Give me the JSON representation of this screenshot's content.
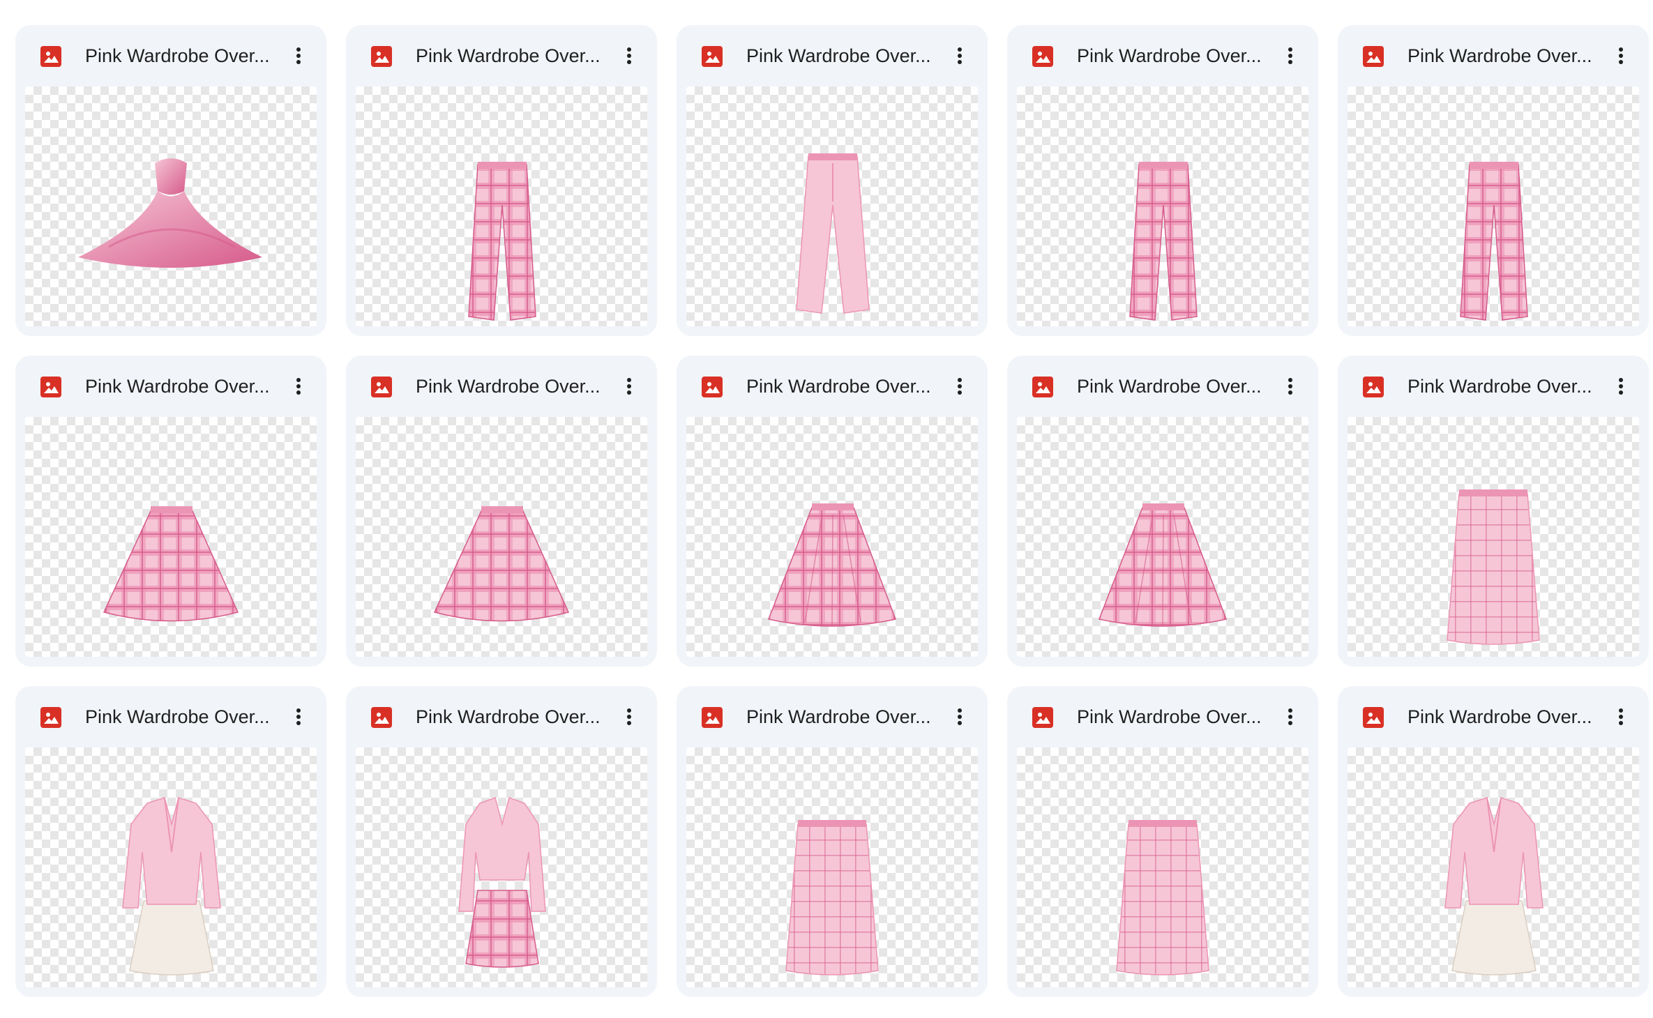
{
  "colors": {
    "card_bg": "#f1f4f9",
    "file_icon": "#d93025",
    "title_text": "#1f1f1f",
    "pink_light": "#f6c6d6",
    "pink_mid": "#ec94b4",
    "pink_dark": "#d65a8a",
    "cream": "#f3ece4"
  },
  "files": [
    {
      "name": "Pink Wardrobe Over...",
      "icon": "image-file-icon",
      "thumbnail": "ball-gown"
    },
    {
      "name": "Pink Wardrobe Over...",
      "icon": "image-file-icon",
      "thumbnail": "plaid-trousers"
    },
    {
      "name": "Pink Wardrobe Over...",
      "icon": "image-file-icon",
      "thumbnail": "solid-trousers"
    },
    {
      "name": "Pink Wardrobe Over...",
      "icon": "image-file-icon",
      "thumbnail": "plaid-trousers"
    },
    {
      "name": "Pink Wardrobe Over...",
      "icon": "image-file-icon",
      "thumbnail": "plaid-trousers"
    },
    {
      "name": "Pink Wardrobe Over...",
      "icon": "image-file-icon",
      "thumbnail": "flared-skirt"
    },
    {
      "name": "Pink Wardrobe Over...",
      "icon": "image-file-icon",
      "thumbnail": "flared-skirt"
    },
    {
      "name": "Pink Wardrobe Over...",
      "icon": "image-file-icon",
      "thumbnail": "pleated-skirt"
    },
    {
      "name": "Pink Wardrobe Over...",
      "icon": "image-file-icon",
      "thumbnail": "pleated-skirt"
    },
    {
      "name": "Pink Wardrobe Over...",
      "icon": "image-file-icon",
      "thumbnail": "pencil-skirt"
    },
    {
      "name": "Pink Wardrobe Over...",
      "icon": "image-file-icon",
      "thumbnail": "blazer-skirt-outfit"
    },
    {
      "name": "Pink Wardrobe Over...",
      "icon": "image-file-icon",
      "thumbnail": "crop-blazer-outfit"
    },
    {
      "name": "Pink Wardrobe Over...",
      "icon": "image-file-icon",
      "thumbnail": "pencil-skirt"
    },
    {
      "name": "Pink Wardrobe Over...",
      "icon": "image-file-icon",
      "thumbnail": "pencil-skirt"
    },
    {
      "name": "Pink Wardrobe Over...",
      "icon": "image-file-icon",
      "thumbnail": "blazer-skirt-outfit"
    }
  ]
}
